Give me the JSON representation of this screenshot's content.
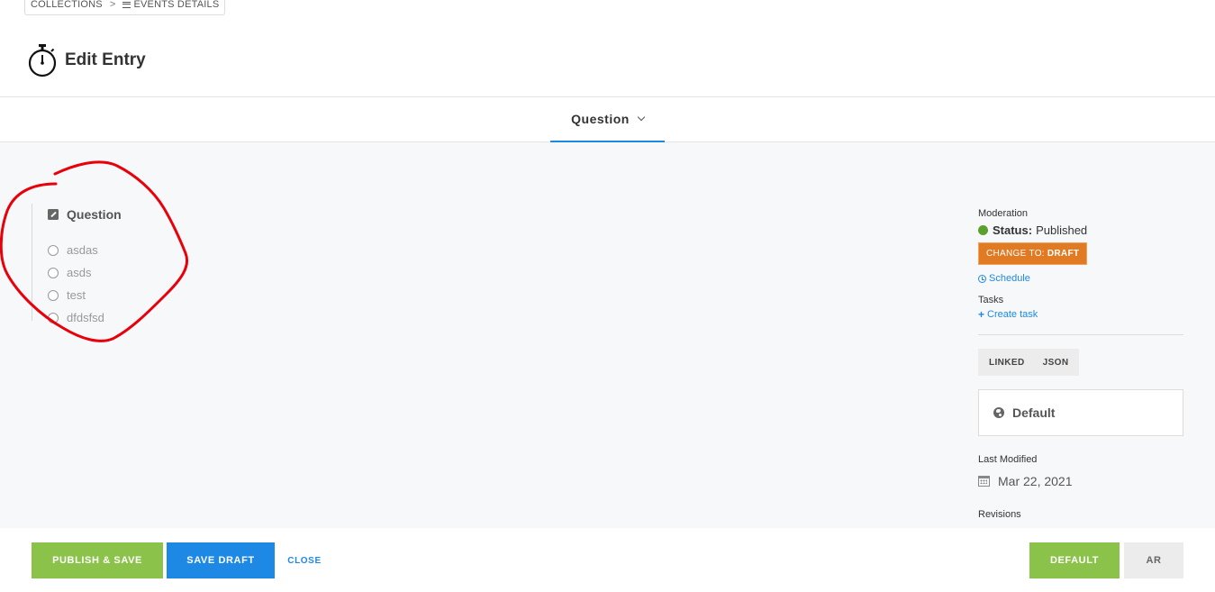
{
  "breadcrumb": {
    "collections": "COLLECTIONS",
    "separator": ">",
    "events": "EVENTS DETAILS"
  },
  "header": {
    "title": "Edit Entry",
    "icon": "stopwatch-icon"
  },
  "tabs": [
    {
      "label": "Question",
      "active": true
    }
  ],
  "question": {
    "label": "Question",
    "options": [
      "asdas",
      "asds",
      "test",
      "dfdsfsd"
    ]
  },
  "annotation": {
    "color": "#e8000b"
  },
  "sidebar": {
    "moderation_label": "Moderation",
    "status_key": "Status:",
    "status_value": "Published",
    "status_color": "#5aa02c",
    "change_prefix": "CHANGE TO:",
    "change_target": "DRAFT",
    "schedule_link": "Schedule",
    "tasks_label": "Tasks",
    "create_task_link": "Create task",
    "view_toggle": [
      "LINKED",
      "JSON"
    ],
    "locale": "Default",
    "last_modified_label": "Last Modified",
    "last_modified_value": "Mar 22, 2021",
    "revisions_label": "Revisions"
  },
  "footer": {
    "publish_label": "PUBLISH & SAVE",
    "save_draft_label": "SAVE DRAFT",
    "close_label": "CLOSE",
    "locales": [
      "DEFAULT",
      "AR"
    ]
  },
  "colors": {
    "primary": "#1e88e5",
    "success": "#8bc34a",
    "warning": "#e07b24"
  }
}
